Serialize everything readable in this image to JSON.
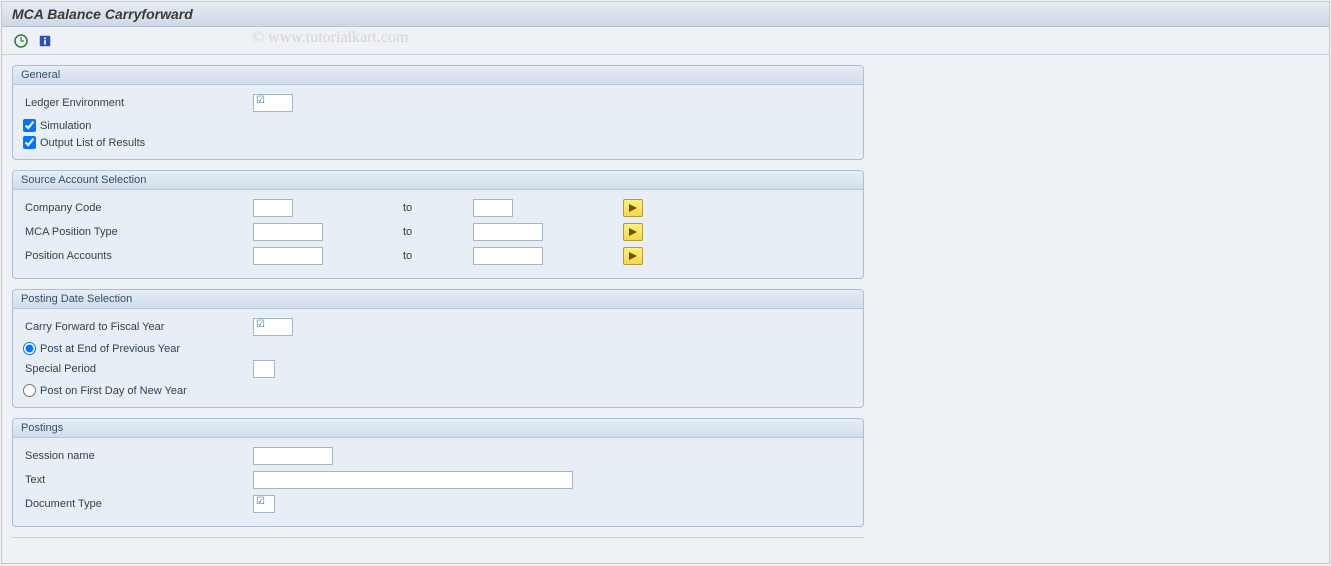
{
  "header": {
    "title": "MCA Balance Carryforward"
  },
  "watermark": "© www.tutorialkart.com",
  "general": {
    "group_title": "General",
    "ledger_env_label": "Ledger Environment",
    "ledger_env_value": "",
    "simulation_label": "Simulation",
    "simulation_checked": true,
    "output_list_label": "Output List of Results",
    "output_list_checked": true
  },
  "source": {
    "group_title": "Source Account Selection",
    "to_label": "to",
    "rows": [
      {
        "label": "Company Code",
        "from": "",
        "to": ""
      },
      {
        "label": "MCA Position Type",
        "from": "",
        "to": ""
      },
      {
        "label": "Position Accounts",
        "from": "",
        "to": ""
      }
    ]
  },
  "posting_date": {
    "group_title": "Posting Date Selection",
    "carry_forward_label": "Carry Forward to Fiscal Year",
    "carry_forward_value": "",
    "radio_prev_label": "Post at End of Previous Year",
    "special_period_label": "Special Period",
    "special_period_value": "",
    "radio_new_label": "Post on First Day of New Year"
  },
  "postings": {
    "group_title": "Postings",
    "session_label": "Session name",
    "session_value": "",
    "text_label": "Text",
    "text_value": "",
    "doc_type_label": "Document Type",
    "doc_type_value": ""
  }
}
